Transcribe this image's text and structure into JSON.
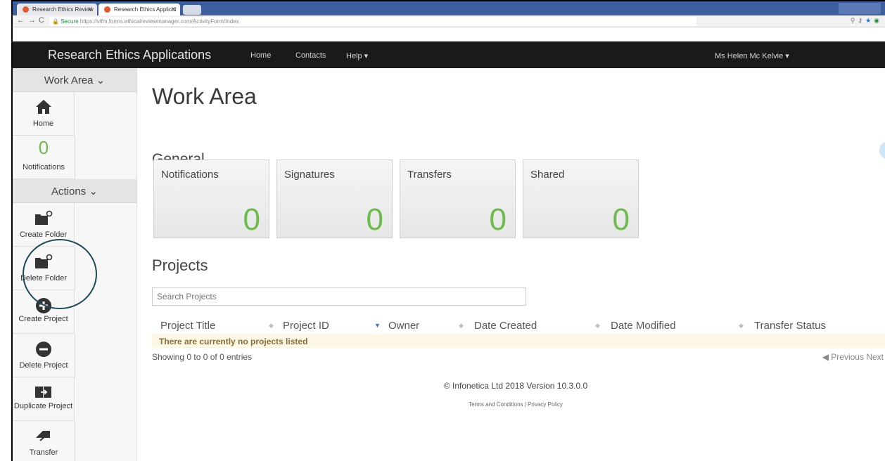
{
  "browser": {
    "tabs": [
      {
        "label": "Research Ethics Review"
      },
      {
        "label": "Research Ethics Applicat"
      }
    ],
    "secure_label": "Secure",
    "url": "https://vifm.forms.ethicalreviewmanager.com/ActivityForm/Index"
  },
  "navbar": {
    "brand": "Research Ethics Applications",
    "links": [
      "Home",
      "Contacts",
      "Help ▾"
    ],
    "user": "Ms Helen Mc Kelvie ▾"
  },
  "sidebar": {
    "work_area_label": "Work Area ⌄",
    "home_label": "Home",
    "notifications_count": "0",
    "notifications_label": "Notifications",
    "actions_label": "Actions ⌄",
    "create_folder_label": "Create Folder",
    "delete_folder_label": "Delete Folder",
    "create_project_label": "Create Project",
    "delete_project_label": "Delete Project",
    "duplicate_project_label": "Duplicate Project",
    "transfer_label": "Transfer"
  },
  "main": {
    "title": "Work Area",
    "general_heading": "General",
    "cards": [
      {
        "title": "Notifications",
        "value": "0"
      },
      {
        "title": "Signatures",
        "value": "0"
      },
      {
        "title": "Transfers",
        "value": "0"
      },
      {
        "title": "Shared",
        "value": "0"
      }
    ],
    "projects_heading": "Projects",
    "search_placeholder": "Search Projects",
    "columns": [
      "Project Title",
      "Project ID",
      "Owner",
      "Date Created",
      "Date Modified",
      "Transfer Status"
    ],
    "empty_message": "There are currently no projects listed",
    "entries_info": "Showing 0 to 0 of 0 entries",
    "previous_label": "◀ Previous",
    "next_label": "Next"
  },
  "footer": {
    "copyright": "© Infonetica Ltd 2018 Version 10.3.0.0",
    "links": "Terms and Conditions | Privacy Policy"
  },
  "colors": {
    "accent_green": "#6dbb4d",
    "navbar_bg": "#1a1a1a",
    "empty_row_bg": "#fcf8e3",
    "highlight_circle": "#1b4a5a"
  }
}
